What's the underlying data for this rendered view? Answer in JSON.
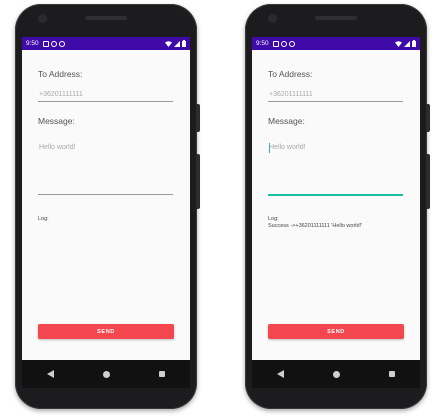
{
  "phones": [
    {
      "status_time": "9:50",
      "to_label": "To Address:",
      "to_value": "+36201111111",
      "message_label": "Message:",
      "message_hint": "Hello world!",
      "log_label": "Log:",
      "log_output": "",
      "send_label": "SEND"
    },
    {
      "status_time": "9:50",
      "to_label": "To Address:",
      "to_value": "+36201111111",
      "message_label": "Message:",
      "message_hint": "Hello world!",
      "log_label": "Log:",
      "log_output": "Success ->+36201111111 'Hello world!'",
      "send_label": "SEND"
    }
  ],
  "icons": {
    "status_left": [
      "notification-icon",
      "settings-icon",
      "sync-icon"
    ],
    "status_right": [
      "wifi-icon",
      "signal-icon",
      "battery-icon"
    ],
    "nav": [
      "back-icon",
      "home-icon",
      "recents-icon"
    ]
  },
  "colors": {
    "status_bar": "#3f0aa8",
    "send_button": "#f4464f",
    "focus_accent": "#1bbfa6"
  }
}
